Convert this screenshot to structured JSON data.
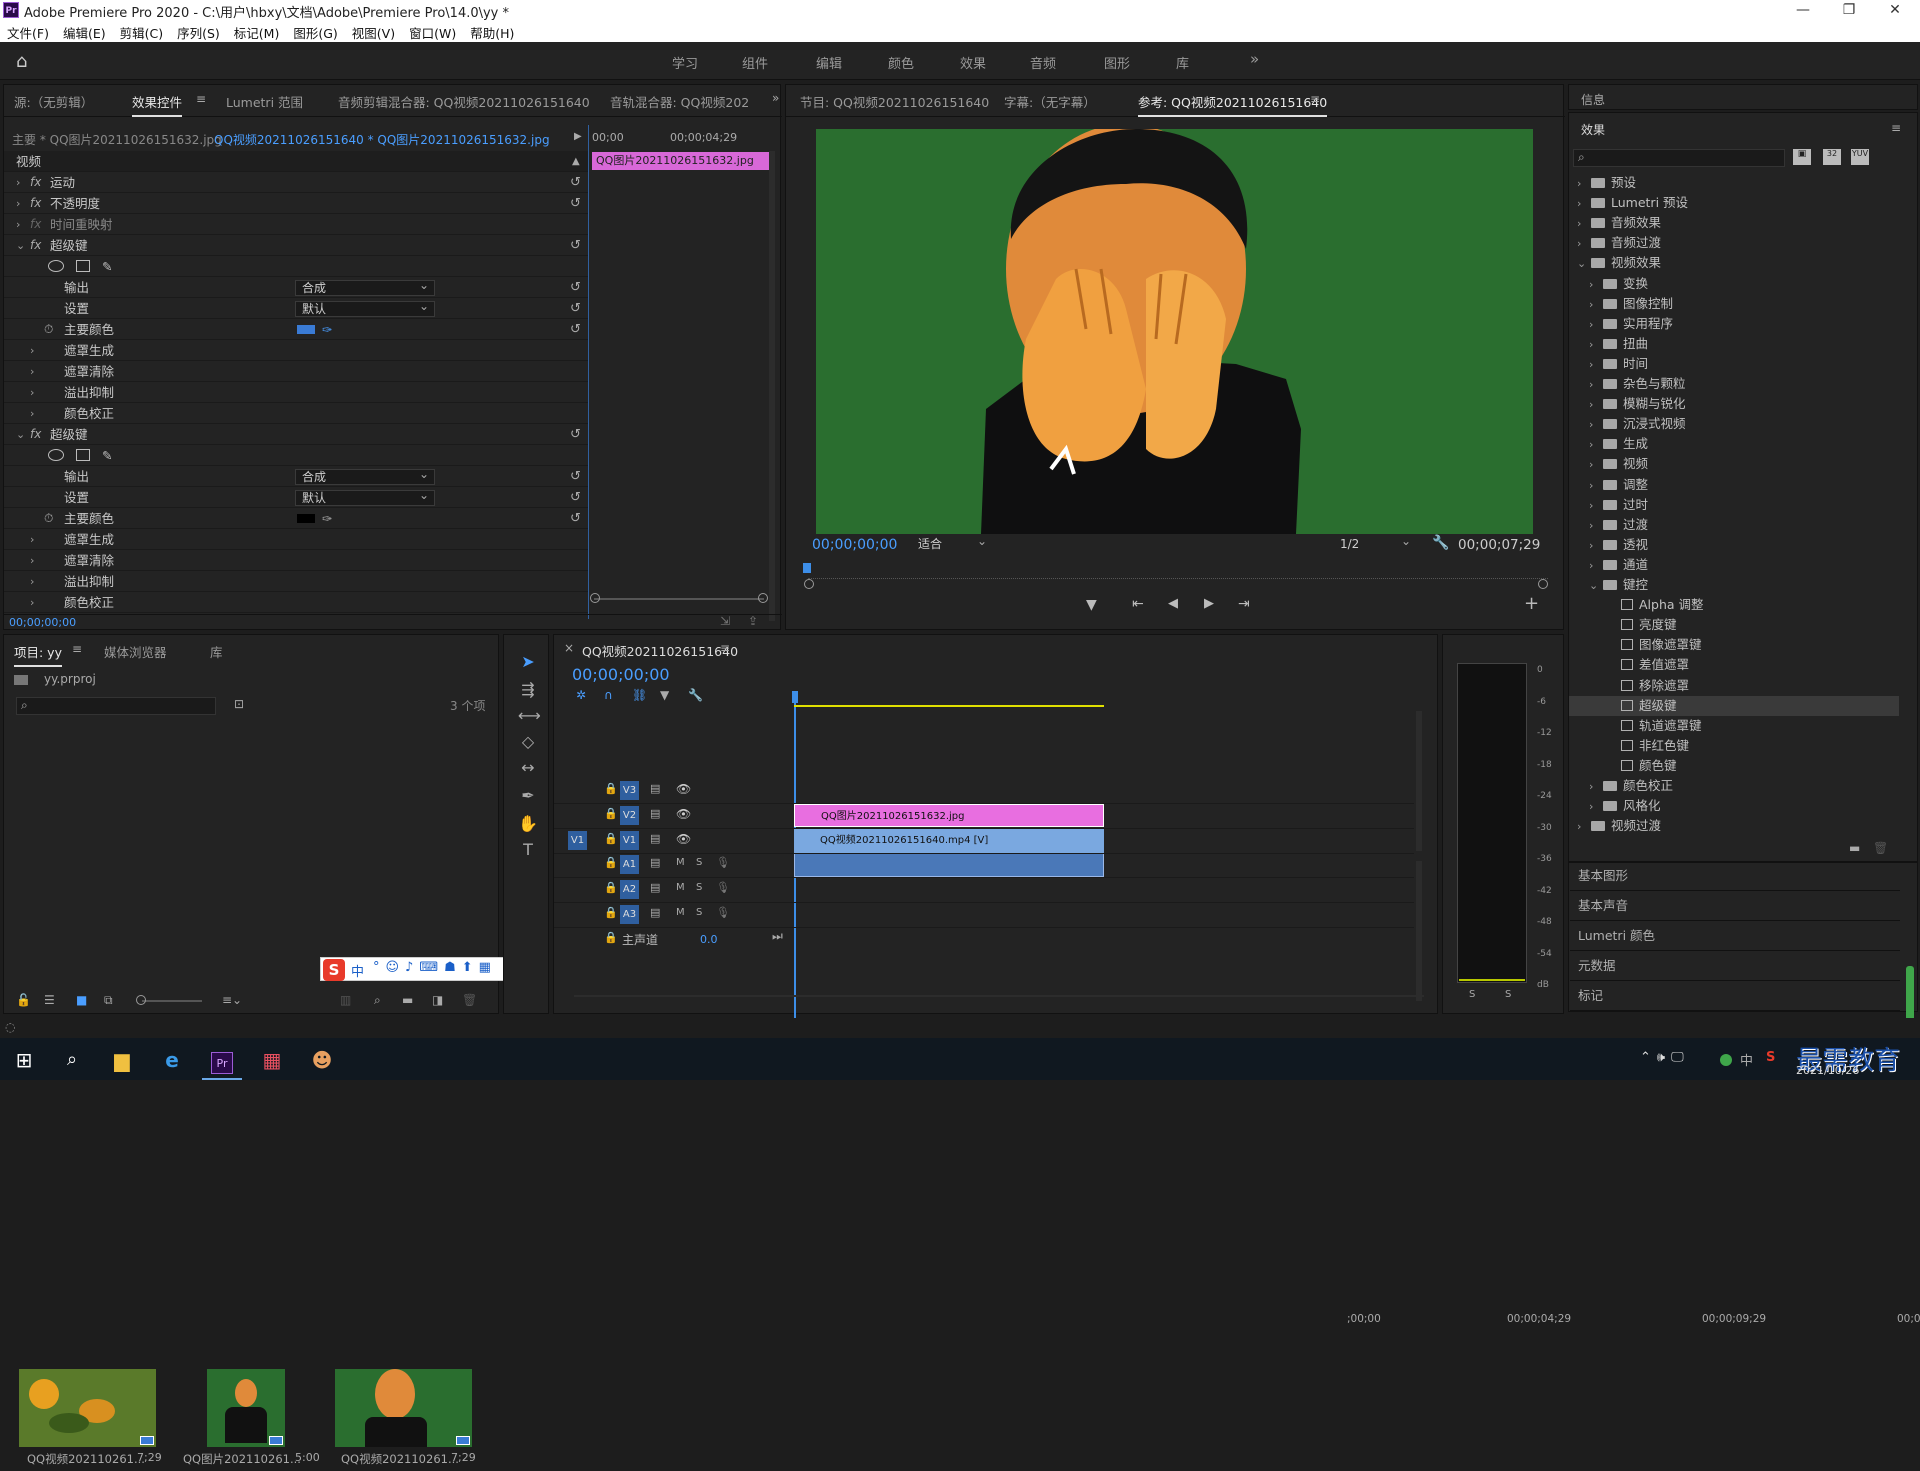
{
  "window": {
    "title": "Adobe Premiere Pro 2020 - C:\\用户\\hbxy\\文档\\Adobe\\Premiere Pro\\14.0\\yy *",
    "app_badge": "Pr"
  },
  "menu": [
    "文件(F)",
    "编辑(E)",
    "剪辑(C)",
    "序列(S)",
    "标记(M)",
    "图形(G)",
    "视图(V)",
    "窗口(W)",
    "帮助(H)"
  ],
  "workspaces": [
    "学习",
    "组件",
    "编辑",
    "颜色",
    "效果",
    "音频",
    "图形",
    "库"
  ],
  "workspace_more": "»",
  "effect_controls": {
    "tabs": [
      "源:（无剪辑）",
      "效果控件",
      "Lumetri 范围",
      "音频剪辑混合器: QQ视频20211026151640",
      "音轨混合器: QQ视频202"
    ],
    "master_label": "主要 * QQ图片20211026151632.jpg",
    "clip_label": "QQ视频20211026151640 * QQ图片20211026151632.jpg",
    "tl_time1": "00;00",
    "tl_time2": "00;00;04;29",
    "clip_bar": "QQ图片20211026151632.jpg",
    "section_video": "视频",
    "motion": "运动",
    "opacity": "不透明度",
    "time_remap": "时间重映射",
    "ultra_key_1": "超级键",
    "output_label": "输出",
    "output_val": "合成",
    "setting_label": "设置",
    "setting_val": "默认",
    "key_color": "主要颜色",
    "sub1": "遮罩生成",
    "sub2": "遮罩清除",
    "sub3": "溢出抑制",
    "sub4": "颜色校正",
    "key_color1": "#3a7bd5",
    "key_color2": "#000000",
    "timecode": "00;00;00;00"
  },
  "program": {
    "tabs": [
      "节目: QQ视频20211026151640",
      "字幕:（无字幕）",
      "参考: QQ视频20211026151640"
    ],
    "timecode": "00;00;00;00",
    "fit": "适合",
    "res": "1/2",
    "duration": "00;00;07;29",
    "screen_bg": "#2a6e2f"
  },
  "info_panel": {
    "title": "信息"
  },
  "effects": {
    "title": "效果",
    "tree": [
      {
        "label": "预设",
        "type": "folder",
        "indent": 0,
        "open": false
      },
      {
        "label": "Lumetri 预设",
        "type": "folder",
        "indent": 0,
        "open": false
      },
      {
        "label": "音频效果",
        "type": "folder",
        "indent": 0,
        "open": false
      },
      {
        "label": "音频过渡",
        "type": "folder",
        "indent": 0,
        "open": false
      },
      {
        "label": "视频效果",
        "type": "folder",
        "indent": 0,
        "open": true
      },
      {
        "label": "变换",
        "type": "folder",
        "indent": 1,
        "open": false
      },
      {
        "label": "图像控制",
        "type": "folder",
        "indent": 1,
        "open": false
      },
      {
        "label": "实用程序",
        "type": "folder",
        "indent": 1,
        "open": false
      },
      {
        "label": "扭曲",
        "type": "folder",
        "indent": 1,
        "open": false
      },
      {
        "label": "时间",
        "type": "folder",
        "indent": 1,
        "open": false
      },
      {
        "label": "杂色与颗粒",
        "type": "folder",
        "indent": 1,
        "open": false
      },
      {
        "label": "模糊与锐化",
        "type": "folder",
        "indent": 1,
        "open": false
      },
      {
        "label": "沉浸式视频",
        "type": "folder",
        "indent": 1,
        "open": false
      },
      {
        "label": "生成",
        "type": "folder",
        "indent": 1,
        "open": false
      },
      {
        "label": "视频",
        "type": "folder",
        "indent": 1,
        "open": false
      },
      {
        "label": "调整",
        "type": "folder",
        "indent": 1,
        "open": false
      },
      {
        "label": "过时",
        "type": "folder",
        "indent": 1,
        "open": false
      },
      {
        "label": "过渡",
        "type": "folder",
        "indent": 1,
        "open": false
      },
      {
        "label": "透视",
        "type": "folder",
        "indent": 1,
        "open": false
      },
      {
        "label": "通道",
        "type": "folder",
        "indent": 1,
        "open": false
      },
      {
        "label": "键控",
        "type": "folder",
        "indent": 1,
        "open": true
      },
      {
        "label": "Alpha 调整",
        "type": "preset",
        "indent": 2
      },
      {
        "label": "亮度键",
        "type": "preset",
        "indent": 2
      },
      {
        "label": "图像遮罩键",
        "type": "preset",
        "indent": 2
      },
      {
        "label": "差值遮罩",
        "type": "preset",
        "indent": 2
      },
      {
        "label": "移除遮罩",
        "type": "preset",
        "indent": 2
      },
      {
        "label": "超级键",
        "type": "preset",
        "indent": 2,
        "selected": true
      },
      {
        "label": "轨道遮罩键",
        "type": "preset",
        "indent": 2
      },
      {
        "label": "非红色键",
        "type": "preset",
        "indent": 2
      },
      {
        "label": "颜色键",
        "type": "preset",
        "indent": 2
      },
      {
        "label": "颜色校正",
        "type": "folder",
        "indent": 1,
        "open": false
      },
      {
        "label": "风格化",
        "type": "folder",
        "indent": 1,
        "open": false
      },
      {
        "label": "视频过渡",
        "type": "folder",
        "indent": 0,
        "open": false
      }
    ]
  },
  "lower_right": [
    "基本图形",
    "基本声音",
    "Lumetri 颜色",
    "元数据",
    "标记"
  ],
  "project": {
    "tabs": [
      "项目: yy",
      "媒体浏览器",
      "库"
    ],
    "file": "yy.prproj",
    "count": "3 个项",
    "items": [
      {
        "name": "QQ视频202110261...",
        "dur": "7;29"
      },
      {
        "name": "QQ图片202110261...",
        "dur": "5:00"
      },
      {
        "name": "QQ视频202110261...",
        "dur": "7;29"
      }
    ]
  },
  "timeline": {
    "tab": "QQ视频20211026151640",
    "timecode": "00;00;00;00",
    "ruler": [
      ";00;00",
      "00;00;04;29",
      "00;00;09;29",
      "00;00;14;29"
    ],
    "tracks_v": [
      "V3",
      "V2",
      "V1"
    ],
    "tracks_a": [
      "A1",
      "A2",
      "A3"
    ],
    "src_v": "V1",
    "master": "主声道",
    "master_val": "0.0",
    "clip_v2": "QQ图片20211026151632.jpg",
    "clip_v1": "QQ视频20211026151640.mp4 [V]",
    "m": "M",
    "s": "S"
  },
  "meter": {
    "ticks": [
      "0",
      "-6",
      "-12",
      "-18",
      "-24",
      "-30",
      "-36",
      "-42",
      "-48",
      "-54",
      "dB"
    ],
    "s": "S"
  },
  "ime": {
    "logo": "S",
    "text": "中"
  },
  "taskbar": {
    "date": "2021/10/26",
    "watermark": "最需教育"
  }
}
